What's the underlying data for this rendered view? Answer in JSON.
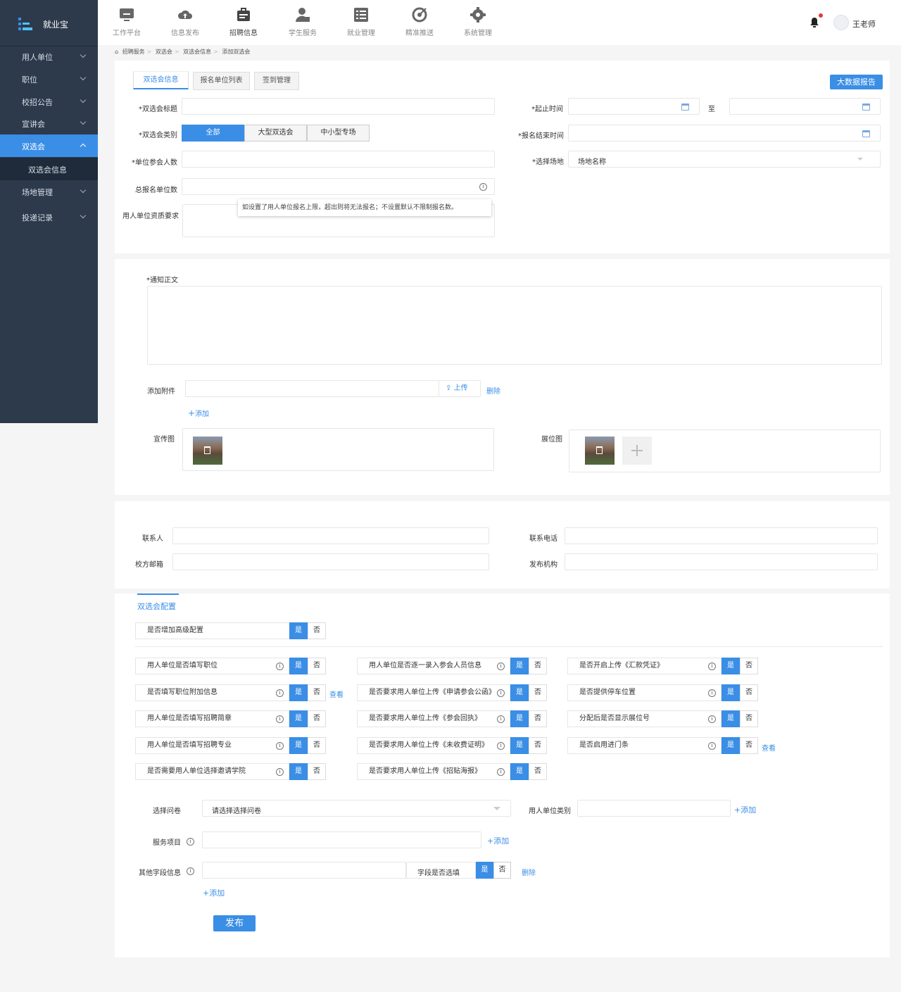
{
  "app": {
    "name": "就业宝"
  },
  "sidebar": {
    "items": [
      {
        "label": "用人单位"
      },
      {
        "label": "职位"
      },
      {
        "label": "校招公告"
      },
      {
        "label": "宣讲会"
      },
      {
        "label": "双选会"
      },
      {
        "label": "双选会信息"
      },
      {
        "label": "场地管理"
      },
      {
        "label": "投递记录"
      }
    ]
  },
  "topnav": {
    "items": [
      {
        "label": "工作平台",
        "icon": "monitor-icon"
      },
      {
        "label": "信息发布",
        "icon": "cloud-upload-icon"
      },
      {
        "label": "招聘信息",
        "icon": "briefcase-icon"
      },
      {
        "label": "学生服务",
        "icon": "user-icon"
      },
      {
        "label": "就业管理",
        "icon": "list-icon"
      },
      {
        "label": "精准推送",
        "icon": "target-icon"
      },
      {
        "label": "系统管理",
        "icon": "gear-icon"
      }
    ],
    "active_index": 2
  },
  "user": {
    "name": "王老师"
  },
  "breadcrumb": {
    "items": [
      "招聘服务",
      "双选会",
      "双选会信息",
      "添加双选会"
    ]
  },
  "tabs": [
    {
      "label": "双选会信息"
    },
    {
      "label": "报名单位列表"
    },
    {
      "label": "签到管理"
    }
  ],
  "bigdata_button": "大数据报告",
  "form": {
    "title_label": "*双选会标题",
    "type_label": "*双选会类别",
    "type_options": [
      "全部",
      "大型双选会",
      "中小型专场"
    ],
    "count_label": "*单位参会人数",
    "total_label": "总报名单位数",
    "qual_label": "用人单位资质要求",
    "tooltip": "如设置了用人单位报名上限，超出则将无法报名；不设置默认不限制报名数。",
    "deadline_label": "*起止时间",
    "to_label": "至",
    "signup_end_label": "*报名结束时间",
    "venue_label": "*选择场地",
    "venue_placeholder": "场地名称"
  },
  "notice": {
    "body_label": "*通知正文",
    "attach_label": "添加附件",
    "upload_label": "上传",
    "delete_label": "删除",
    "add_label": "添加",
    "promo_label": "宣传图",
    "booth_label": "展位图"
  },
  "contact": {
    "person_label": "联系人",
    "phone_label": "联系电话",
    "email_label": "校方邮箱",
    "org_label": "发布机构"
  },
  "config": {
    "title": "双选会配置",
    "advanced_label": "是否增加高级配置",
    "yes": "是",
    "no": "否",
    "view": "查看",
    "col1": [
      "用人单位是否填写职位",
      "是否填写职位附加信息",
      "用人单位是否填写招聘简章",
      "用人单位是否填写招聘专业",
      "是否需要用人单位选择邀请学院"
    ],
    "col2": [
      "用人单位是否逐一录入参会人员信息",
      "是否要求用人单位上传《申请参会公函》",
      "是否要求用人单位上传《参会回执》",
      "是否要求用人单位上传《未收费证明》",
      "是否要求用人单位上传《招贴海报》"
    ],
    "col3": [
      "是否开启上传《汇款凭证》",
      "是否提供停车位置",
      "分配后是否显示展位号",
      "是否启用进门条"
    ],
    "survey_label": "选择问卷",
    "survey_placeholder": "请选择选择问卷",
    "category_label": "用人单位类别",
    "add": "+添加",
    "service_label": "服务项目",
    "other_label": "其他字段信息",
    "required_label": "字段是否选填",
    "delete": "删除",
    "publish": "发布"
  }
}
